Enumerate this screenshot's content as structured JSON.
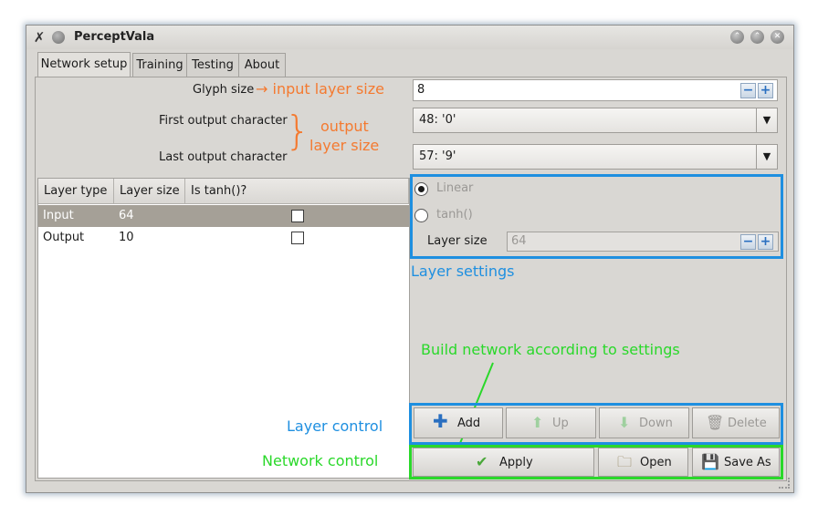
{
  "window": {
    "title": "PerceptVala",
    "minimize_label": "⌃",
    "maximize_label": "⌃",
    "close_label": "✕"
  },
  "tabs": [
    "Network setup",
    "Training",
    "Testing",
    "About"
  ],
  "form": {
    "glyph_size_label": "Glyph size",
    "glyph_size_value": "8",
    "first_output_label": "First output character",
    "first_output_value": "48: '0'",
    "last_output_label": "Last output character",
    "last_output_value": "57: '9'"
  },
  "annotations": {
    "input_layer": "→ input layer size",
    "output_layer_line1": "output",
    "output_layer_line2": "layer size",
    "layer_settings": "Layer settings",
    "build_network": "Build network according to settings",
    "layer_control": "Layer control",
    "network_control": "Network control",
    "colors": {
      "orange": "#f47a30",
      "blue": "#1e8fe0",
      "green": "#2ad82a"
    }
  },
  "table": {
    "headers": [
      "Layer type",
      "Layer size",
      "Is tanh()?"
    ],
    "rows": [
      {
        "type": "Input",
        "size": "64",
        "tanh": false,
        "selected": true
      },
      {
        "type": "Output",
        "size": "10",
        "tanh": false,
        "selected": false
      }
    ]
  },
  "layer_settings": {
    "linear_label": "Linear",
    "tanh_label": "tanh()",
    "selected": "Linear",
    "layer_size_label": "Layer size",
    "layer_size_value": "64"
  },
  "layer_buttons": {
    "add": "Add",
    "up": "Up",
    "down": "Down",
    "delete": "Delete"
  },
  "network_buttons": {
    "apply": "Apply",
    "open": "Open",
    "save_as": "Save As"
  },
  "icons": {
    "app": "tools-icon",
    "add": "plus-icon",
    "up": "arrow-up-icon",
    "down": "arrow-down-icon",
    "delete": "trash-icon",
    "apply": "check-icon",
    "open": "folder-icon",
    "save": "save-icon"
  }
}
